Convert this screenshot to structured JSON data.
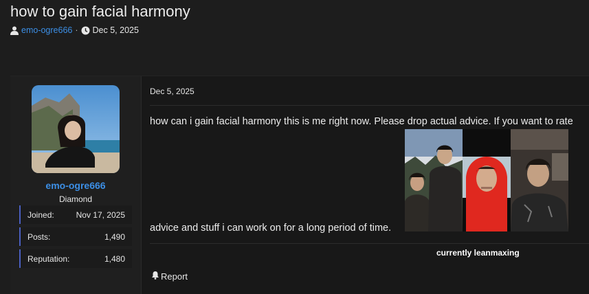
{
  "thread": {
    "title": "how to gain facial harmony",
    "author": "emo-ogre666",
    "separator": "·",
    "date": "Dec 5, 2025"
  },
  "user": {
    "name": "emo-ogre666",
    "title": "Diamond",
    "stats": [
      {
        "label": "Joined:",
        "value": "Nov 17, 2025"
      },
      {
        "label": "Posts:",
        "value": "1,490"
      },
      {
        "label": "Reputation:",
        "value": "1,480"
      }
    ]
  },
  "post": {
    "date": "Dec 5, 2025",
    "body_line1": "how can i gain facial harmony this is me right now. Please drop actual advice. If you want to rate",
    "body_line2": "advice and stuff i can work on for a long period of time.",
    "signature": "currently leanmaxing",
    "report_label": "Report"
  },
  "colors": {
    "accent": "#3c8fe6",
    "background": "#1d1d1d",
    "stat_border": "#4a5fc0"
  },
  "icons": [
    "user-icon",
    "clock-icon",
    "bell-icon"
  ]
}
